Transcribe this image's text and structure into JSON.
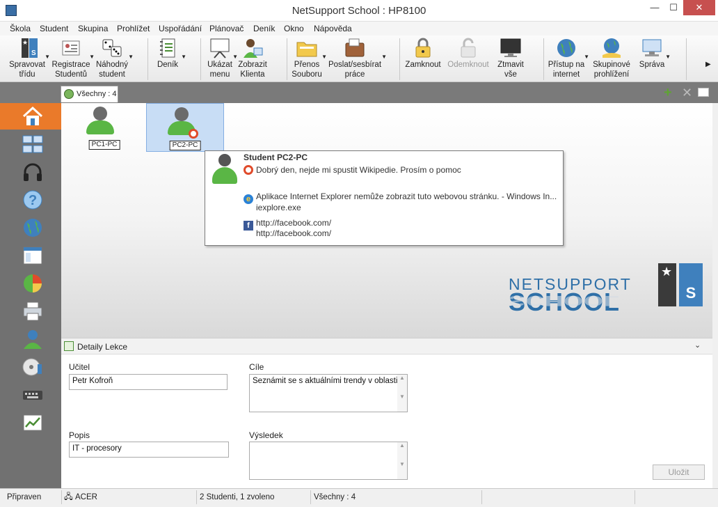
{
  "window": {
    "title": "NetSupport School : HP8100",
    "minimize": "—",
    "maximize": "☐",
    "close": "✕"
  },
  "menu": [
    "Škola",
    "Student",
    "Skupina",
    "Prohlížet",
    "Uspořádání",
    "Plánovač",
    "Deník",
    "Okno",
    "Nápověda"
  ],
  "toolbar": [
    {
      "name": "spravovat-tridu",
      "line1": "Spravovat",
      "line2": "třídu",
      "icon": "class-icon"
    },
    {
      "name": "registrace-studentu",
      "line1": "Registrace",
      "line2": "Studentů",
      "icon": "register-icon"
    },
    {
      "name": "nahodny-student",
      "line1": "Náhodný",
      "line2": "student",
      "icon": "dice-icon"
    },
    {
      "name": "denik",
      "line1": "Deník",
      "line2": "",
      "icon": "journal-icon"
    },
    {
      "name": "ukazat-menu",
      "line1": "Ukázat",
      "line2": "menu",
      "icon": "presentation-icon"
    },
    {
      "name": "zobrazit-klienta",
      "line1": "Zobrazit",
      "line2": "Klienta",
      "icon": "view-client-icon"
    },
    {
      "name": "prenos-souboru",
      "line1": "Přenos",
      "line2": "Souboru",
      "icon": "folder-icon"
    },
    {
      "name": "poslat-sesbirat",
      "line1": "Poslat/sesbírat",
      "line2": "práce",
      "icon": "briefcase-icon"
    },
    {
      "name": "zamknout",
      "line1": "Zamknout",
      "line2": "",
      "icon": "lock-icon"
    },
    {
      "name": "odemknout",
      "line1": "Odemknout",
      "line2": "",
      "icon": "unlock-icon"
    },
    {
      "name": "ztmavit-vse",
      "line1": "Ztmavit",
      "line2": "vše",
      "icon": "monitor-icon"
    },
    {
      "name": "pristup-na-internet",
      "line1": "Přístup na",
      "line2": "internet",
      "icon": "globe-icon"
    },
    {
      "name": "skupinove-prohlizeni",
      "line1": "Skupinové",
      "line2": "prohlížení",
      "icon": "group-browse-icon"
    },
    {
      "name": "sprava",
      "line1": "Správa",
      "line2": "",
      "icon": "computer-icon"
    }
  ],
  "tab": {
    "label": "Všechny : 4"
  },
  "students": [
    {
      "name": "PC1-PC"
    },
    {
      "name": "PC2-PC"
    }
  ],
  "tooltip": {
    "title": "Student PC2-PC",
    "help": "Dobrý den, nejde mi spustit Wikipedie. Prosím o pomoc",
    "app": "Aplikace Internet Explorer nemůže zobrazit tuto webovou stránku. - Windows In...",
    "app_exe": "iexplore.exe",
    "site": "http://facebook.com/",
    "site2": "http://facebook.com/"
  },
  "brand": {
    "line1": "NETSUPPORT",
    "line2": "SCHOOL",
    "logo_letter": "S"
  },
  "details": {
    "title": "Detaily Lekce",
    "teacher_label": "Učitel",
    "teacher": "Petr Kofroň",
    "goals_label": "Cíle",
    "goals": "Seznámit se s aktuálními trendy v oblasti pro",
    "desc_label": "Popis",
    "desc": "IT - procesory",
    "result_label": "Výsledek",
    "result": "",
    "save": "Uložit"
  },
  "status": {
    "ready": "Připraven",
    "host": "ACER",
    "count": "2 Studenti, 1 zvoleno",
    "group": "Všechny : 4"
  }
}
